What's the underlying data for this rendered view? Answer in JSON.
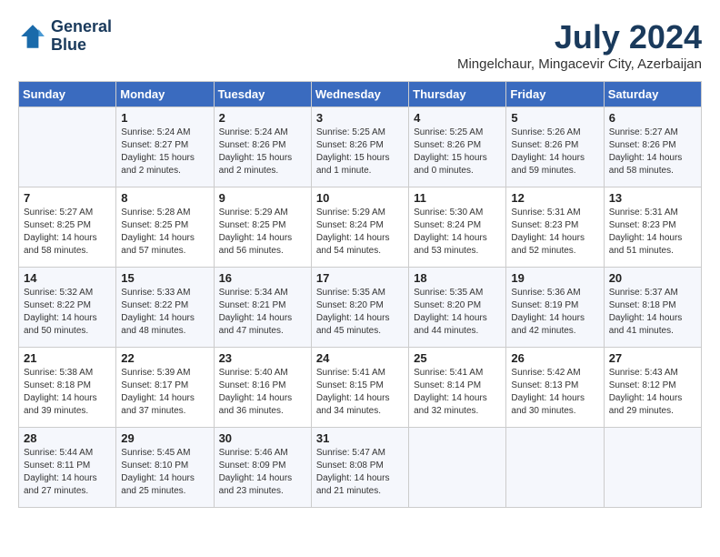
{
  "header": {
    "logo_line1": "General",
    "logo_line2": "Blue",
    "month_title": "July 2024",
    "location": "Mingelchaur, Mingacevir City, Azerbaijan"
  },
  "days_of_week": [
    "Sunday",
    "Monday",
    "Tuesday",
    "Wednesday",
    "Thursday",
    "Friday",
    "Saturday"
  ],
  "weeks": [
    [
      {
        "day": "",
        "text": ""
      },
      {
        "day": "1",
        "text": "Sunrise: 5:24 AM\nSunset: 8:27 PM\nDaylight: 15 hours\nand 2 minutes."
      },
      {
        "day": "2",
        "text": "Sunrise: 5:24 AM\nSunset: 8:26 PM\nDaylight: 15 hours\nand 2 minutes."
      },
      {
        "day": "3",
        "text": "Sunrise: 5:25 AM\nSunset: 8:26 PM\nDaylight: 15 hours\nand 1 minute."
      },
      {
        "day": "4",
        "text": "Sunrise: 5:25 AM\nSunset: 8:26 PM\nDaylight: 15 hours\nand 0 minutes."
      },
      {
        "day": "5",
        "text": "Sunrise: 5:26 AM\nSunset: 8:26 PM\nDaylight: 14 hours\nand 59 minutes."
      },
      {
        "day": "6",
        "text": "Sunrise: 5:27 AM\nSunset: 8:26 PM\nDaylight: 14 hours\nand 58 minutes."
      }
    ],
    [
      {
        "day": "7",
        "text": "Sunrise: 5:27 AM\nSunset: 8:25 PM\nDaylight: 14 hours\nand 58 minutes."
      },
      {
        "day": "8",
        "text": "Sunrise: 5:28 AM\nSunset: 8:25 PM\nDaylight: 14 hours\nand 57 minutes."
      },
      {
        "day": "9",
        "text": "Sunrise: 5:29 AM\nSunset: 8:25 PM\nDaylight: 14 hours\nand 56 minutes."
      },
      {
        "day": "10",
        "text": "Sunrise: 5:29 AM\nSunset: 8:24 PM\nDaylight: 14 hours\nand 54 minutes."
      },
      {
        "day": "11",
        "text": "Sunrise: 5:30 AM\nSunset: 8:24 PM\nDaylight: 14 hours\nand 53 minutes."
      },
      {
        "day": "12",
        "text": "Sunrise: 5:31 AM\nSunset: 8:23 PM\nDaylight: 14 hours\nand 52 minutes."
      },
      {
        "day": "13",
        "text": "Sunrise: 5:31 AM\nSunset: 8:23 PM\nDaylight: 14 hours\nand 51 minutes."
      }
    ],
    [
      {
        "day": "14",
        "text": "Sunrise: 5:32 AM\nSunset: 8:22 PM\nDaylight: 14 hours\nand 50 minutes."
      },
      {
        "day": "15",
        "text": "Sunrise: 5:33 AM\nSunset: 8:22 PM\nDaylight: 14 hours\nand 48 minutes."
      },
      {
        "day": "16",
        "text": "Sunrise: 5:34 AM\nSunset: 8:21 PM\nDaylight: 14 hours\nand 47 minutes."
      },
      {
        "day": "17",
        "text": "Sunrise: 5:35 AM\nSunset: 8:20 PM\nDaylight: 14 hours\nand 45 minutes."
      },
      {
        "day": "18",
        "text": "Sunrise: 5:35 AM\nSunset: 8:20 PM\nDaylight: 14 hours\nand 44 minutes."
      },
      {
        "day": "19",
        "text": "Sunrise: 5:36 AM\nSunset: 8:19 PM\nDaylight: 14 hours\nand 42 minutes."
      },
      {
        "day": "20",
        "text": "Sunrise: 5:37 AM\nSunset: 8:18 PM\nDaylight: 14 hours\nand 41 minutes."
      }
    ],
    [
      {
        "day": "21",
        "text": "Sunrise: 5:38 AM\nSunset: 8:18 PM\nDaylight: 14 hours\nand 39 minutes."
      },
      {
        "day": "22",
        "text": "Sunrise: 5:39 AM\nSunset: 8:17 PM\nDaylight: 14 hours\nand 37 minutes."
      },
      {
        "day": "23",
        "text": "Sunrise: 5:40 AM\nSunset: 8:16 PM\nDaylight: 14 hours\nand 36 minutes."
      },
      {
        "day": "24",
        "text": "Sunrise: 5:41 AM\nSunset: 8:15 PM\nDaylight: 14 hours\nand 34 minutes."
      },
      {
        "day": "25",
        "text": "Sunrise: 5:41 AM\nSunset: 8:14 PM\nDaylight: 14 hours\nand 32 minutes."
      },
      {
        "day": "26",
        "text": "Sunrise: 5:42 AM\nSunset: 8:13 PM\nDaylight: 14 hours\nand 30 minutes."
      },
      {
        "day": "27",
        "text": "Sunrise: 5:43 AM\nSunset: 8:12 PM\nDaylight: 14 hours\nand 29 minutes."
      }
    ],
    [
      {
        "day": "28",
        "text": "Sunrise: 5:44 AM\nSunset: 8:11 PM\nDaylight: 14 hours\nand 27 minutes."
      },
      {
        "day": "29",
        "text": "Sunrise: 5:45 AM\nSunset: 8:10 PM\nDaylight: 14 hours\nand 25 minutes."
      },
      {
        "day": "30",
        "text": "Sunrise: 5:46 AM\nSunset: 8:09 PM\nDaylight: 14 hours\nand 23 minutes."
      },
      {
        "day": "31",
        "text": "Sunrise: 5:47 AM\nSunset: 8:08 PM\nDaylight: 14 hours\nand 21 minutes."
      },
      {
        "day": "",
        "text": ""
      },
      {
        "day": "",
        "text": ""
      },
      {
        "day": "",
        "text": ""
      }
    ]
  ]
}
